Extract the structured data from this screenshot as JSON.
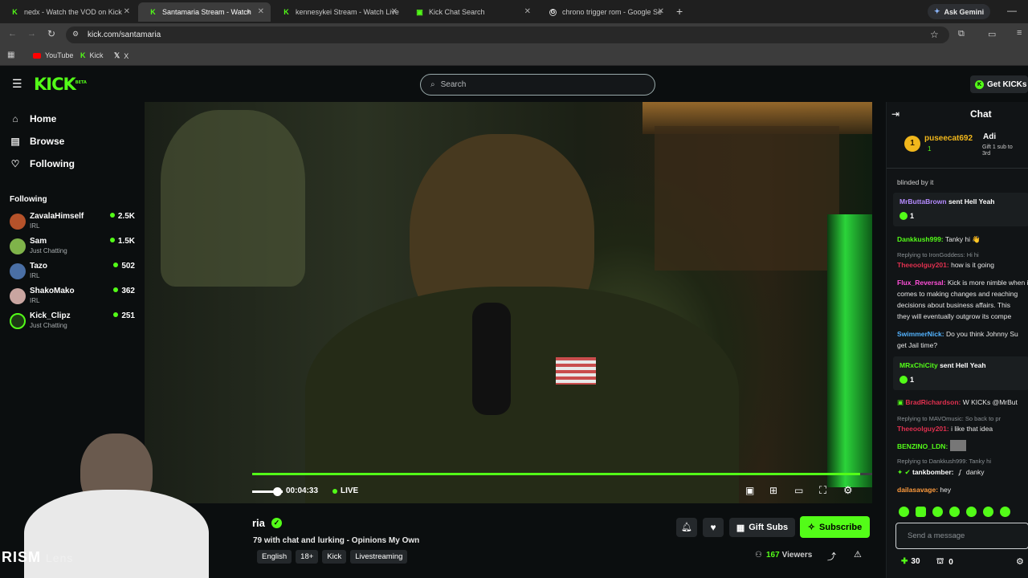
{
  "browser": {
    "tabs": [
      {
        "title": "nedx - Watch the VOD on Kick",
        "active": false
      },
      {
        "title": "Santamaria Stream - Watch",
        "active": true
      },
      {
        "title": "kennesykei Stream - Watch Live",
        "active": false
      },
      {
        "title": "Kick Chat Search",
        "active": false
      },
      {
        "title": "chrono trigger rom - Google Se",
        "active": false
      }
    ],
    "new_tab": "+",
    "ask_gemini": "Ask Gemini",
    "url": "kick.com/santamaria",
    "bookmarks": [
      "YouTube",
      "Kick",
      "X"
    ]
  },
  "kick": {
    "logo": "KICK",
    "logo_badge": "BETA",
    "search_placeholder": "Search",
    "get_kicks": "Get KICKs"
  },
  "sidebar": {
    "nav": [
      {
        "label": "Home",
        "icon": "home-icon"
      },
      {
        "label": "Browse",
        "icon": "browse-icon"
      },
      {
        "label": "Following",
        "icon": "heart-icon"
      }
    ],
    "following_title": "Following",
    "following": [
      {
        "name": "ZavalaHimself",
        "category": "IRL",
        "viewers": "2.5K",
        "color": "#b5522a"
      },
      {
        "name": "Sam",
        "category": "Just Chatting",
        "viewers": "1.5K",
        "color": "#7fb34a"
      },
      {
        "name": "Tazo",
        "category": "IRL",
        "viewers": "502",
        "color": "#4a6fa5"
      },
      {
        "name": "ShakoMako",
        "category": "IRL",
        "viewers": "362",
        "color": "#c9a5a0"
      },
      {
        "name": "Kick_Clipz",
        "category": "Just Chatting",
        "viewers": "251",
        "color": "#53fc18"
      }
    ]
  },
  "player": {
    "time": "00:04:33",
    "live": "LIVE",
    "progress": 0.98
  },
  "stream": {
    "name_partial": "ria",
    "title_partial": "79 with chat and lurking - Opinions My Own",
    "tags": [
      "English",
      "18+",
      "Kick",
      "Livestreaming"
    ],
    "gift_subs": "Gift Subs",
    "subscribe": "Subscribe",
    "viewers": "167",
    "viewers_label": "Viewers"
  },
  "overlay": {
    "watermark": "RISM",
    "watermark_faint": "Lens"
  },
  "chat": {
    "title": "Chat",
    "pinned": [
      {
        "rank": "1",
        "name": "puseecat692",
        "count": "1"
      },
      {
        "name": "Adi",
        "text": "Gift 1 sub to",
        "rank": "3rd"
      }
    ],
    "send_placeholder": "Send a message",
    "kicks_count": "30",
    "second_count": "0",
    "messages": [
      {
        "user": "",
        "text": "blinded by it",
        "ucolor": "#e6e6e6"
      },
      {
        "user": "MrButtaBrown",
        "text": "sent Hell Yeah",
        "ucolor": "#b58bff",
        "count": "1"
      },
      {
        "user": "Dankkush999:",
        "text": "Tanky hi 👋",
        "ucolor": "#53fc18"
      },
      {
        "user": "Theeoolguy201:",
        "text": "how is it going",
        "ucolor": "#e0304f",
        "reply": "Replying to IronGoddess: Hi hi"
      },
      {
        "user": "Flux_Reversal:",
        "text": "Kick is more nimble when it",
        "ucolor": "#ff4fd8",
        "extra": [
          "comes to making changes and reaching",
          "decisions about business affairs. This",
          "they will eventually outgrow its compe"
        ]
      },
      {
        "user": "SwimmerNick:",
        "text": "Do you think Johnny Su",
        "ucolor": "#53b3ff",
        "extra": [
          "get Jail time?"
        ]
      },
      {
        "user": "MRxChiCity",
        "text": "sent Hell Yeah",
        "ucolor": "#53fc18",
        "count": "1"
      },
      {
        "user": "BradRichardson:",
        "text": "W KICKs @MrBut",
        "ucolor": "#e0304f"
      },
      {
        "user": "Theeoolguy201:",
        "text": "i like that idea",
        "ucolor": "#e0304f",
        "reply": "Replying to MAVOmusic: So back to pr"
      },
      {
        "user": "BENZINO_LDN:",
        "text": "",
        "ucolor": "#53fc18"
      },
      {
        "user": "tankbomber:",
        "text": "danky",
        "ucolor": "#ffffff",
        "reply": "Replying to Dankkush999: Tanky hi"
      },
      {
        "user": "dailasavage:",
        "text": "hey",
        "ucolor": "#ff9b3d"
      }
    ]
  },
  "colors": {
    "kick_green": "#53fc18",
    "bg": "#0b0e0f"
  }
}
